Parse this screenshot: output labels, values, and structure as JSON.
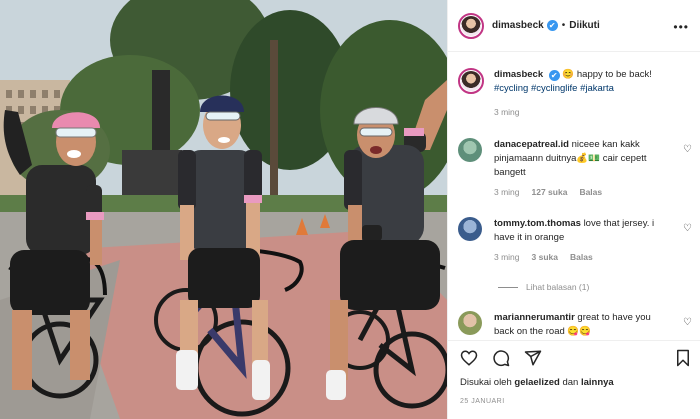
{
  "header": {
    "username": "dimasbeck",
    "verified_mark": "✔",
    "separator": "•",
    "follow_status": "Diikuti",
    "more_icon": "more-horizontal-icon"
  },
  "caption": {
    "username": "dimasbeck",
    "verified_mark": "✔",
    "text": "😊 happy to be back!",
    "hashtags": "#cycling #cyclinglife #jakarta",
    "time": "3 ming"
  },
  "comments": [
    {
      "username": "danacepatreal.id",
      "text": "niceee kan kakk pinjamaann duitnya💰💵 cair cepett bangett",
      "time": "3 ming",
      "likes": "127 suka",
      "reply": "Balas",
      "avatar_color": "#5e8f7a"
    },
    {
      "username": "tommy.tom.thomas",
      "text": "love that jersey. i have it in orange",
      "time": "3 ming",
      "likes": "3 suka",
      "reply": "Balas",
      "view_replies": "Lihat balasan (1)",
      "avatar_color": "#3a5c8c"
    },
    {
      "username": "mariannerumantir",
      "text": "great to have you back on the road 😋😋",
      "avatar_color": "#b88a6a"
    }
  ],
  "actions": {
    "like_icon": "heart-icon",
    "comment_icon": "comment-icon",
    "share_icon": "share-icon",
    "save_icon": "bookmark-icon"
  },
  "likes_line": {
    "prefix": "Disukai oleh",
    "user": "gelaelized",
    "conjunction": "dan",
    "others": "lainnya"
  },
  "post_date": "25 JANUARI",
  "colors": {
    "link": "#00376b",
    "verified": "#3897f0",
    "muted": "#8e8e8e"
  }
}
